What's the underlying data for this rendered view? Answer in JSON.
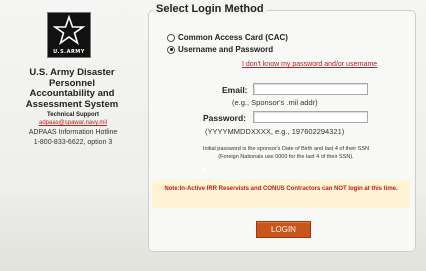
{
  "branding": {
    "logo_text": "U.S.ARMY",
    "org_title_lines": [
      "U.S. Army Disaster",
      "Personnel",
      "Accountability and",
      "Assessment System"
    ],
    "support_title": "Technical Support",
    "support_email": "adpaas@spawar.navy.mil",
    "hotline_lines": [
      "ADPAAS Information Hotline",
      "1-800-833-6622, option 3"
    ]
  },
  "login": {
    "legend": "Select Login Method",
    "methods": [
      {
        "label": "Common Access Card (CAC)",
        "checked": false
      },
      {
        "label": "Username and Password",
        "checked": true
      }
    ],
    "forgot_link": "I don't know my password and/or username",
    "email_label": "Email:",
    "email_value": "",
    "email_hint": "(e.g., Sponsor's .mil addr)",
    "password_label": "Password:",
    "password_value": "",
    "password_hint": "(YYYYMMDDXXXX, e.g., 197602294321)",
    "initial_password_note": "Initial password is the sponsor's Date of Birth and last 4 of their SSN",
    "foreign_note": "(Foreign Nationals use 0000 for the last 4 of their SSN).",
    "warning": "Note:In-Active IRR Reservists and CONUS Contractors can NOT login at this time.",
    "login_button": "LOGIN"
  },
  "colors": {
    "accent_red": "#c02020",
    "button": "#c8551a",
    "warning_bg": "#fff5d6"
  }
}
